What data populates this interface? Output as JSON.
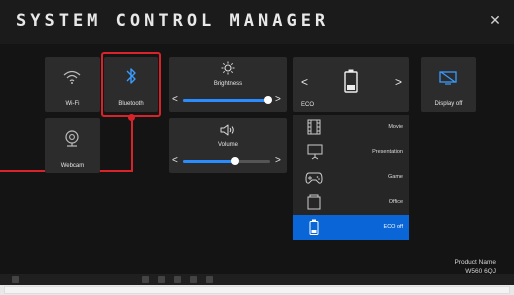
{
  "window": {
    "title": "SYSTEM CONTROL MANAGER",
    "close_glyph": "✕"
  },
  "tiles": {
    "wifi": {
      "label": "Wi-Fi",
      "icon": "wifi-icon"
    },
    "bluetooth": {
      "label": "Bluetooth",
      "icon": "bluetooth-icon",
      "highlighted": true,
      "highlight_color": "#d8232a"
    },
    "webcam": {
      "label": "Webcam",
      "icon": "webcam-icon"
    },
    "brightness": {
      "label": "Brightness",
      "icon": "sun-icon",
      "level": 0.98
    },
    "volume": {
      "label": "Volume",
      "icon": "speaker-icon",
      "level": 0.6
    },
    "display_off": {
      "label": "Display off",
      "icon": "display-off-icon"
    }
  },
  "eco": {
    "label": "ECO",
    "prev_glyph": "<",
    "next_glyph": ">",
    "icon": "battery-icon",
    "modes": [
      {
        "label": "Movie",
        "icon": "film-icon",
        "active": false
      },
      {
        "label": "Presentation",
        "icon": "presentation-icon",
        "active": false
      },
      {
        "label": "Game",
        "icon": "gamepad-icon",
        "active": false
      },
      {
        "label": "Office",
        "icon": "office-icon",
        "active": false
      },
      {
        "label": "ECO off",
        "icon": "battery-icon",
        "active": true
      }
    ]
  },
  "slider_arrows": {
    "left": "<",
    "right": ">"
  },
  "product": {
    "name_label": "Product Name",
    "model": "W560 6QJ"
  },
  "colors": {
    "accent": "#0a66d6",
    "slider": "#2a8cff",
    "callout": "#d8232a",
    "tile": "#2c2c2c",
    "background": "#141414"
  }
}
